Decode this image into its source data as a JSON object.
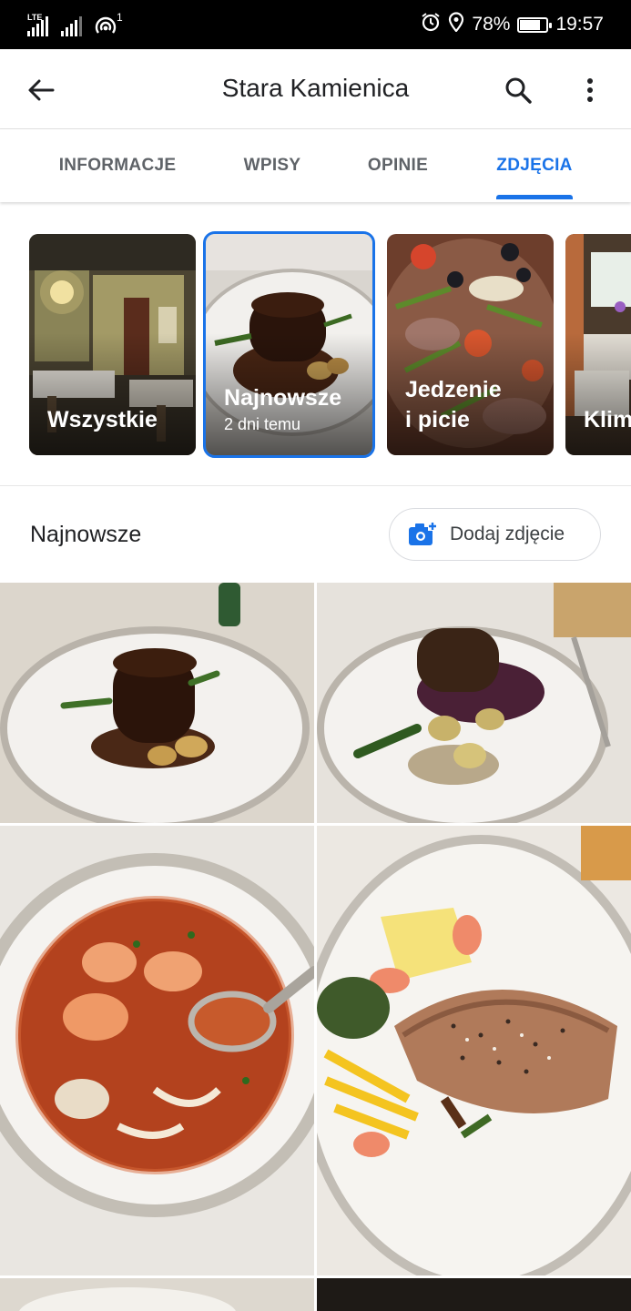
{
  "status_bar": {
    "network_label": "LTE",
    "hotspot_count": "1",
    "battery": "78%",
    "battery_level": 0.78,
    "time": "19:57"
  },
  "app_bar": {
    "title": "Stara Kamienica",
    "back_icon": "arrow-left-icon",
    "search_icon": "search-icon",
    "menu_icon": "more-vertical-icon"
  },
  "tabs": [
    {
      "label": "INFORMACJE",
      "active": false
    },
    {
      "label": "WPISY",
      "active": false
    },
    {
      "label": "OPINIE",
      "active": false
    },
    {
      "label": "ZDJĘCIA",
      "active": true
    }
  ],
  "categories": [
    {
      "label": "Wszystkie",
      "sub": ""
    },
    {
      "label": "Najnowsze",
      "sub": "2 dni temu",
      "selected": true
    },
    {
      "label_line1": "Jedzenie",
      "label_line2": "i picie"
    },
    {
      "label": "Klim"
    }
  ],
  "section": {
    "heading": "Najnowsze",
    "add_photo_label": "Dodaj zdjęcie"
  },
  "colors": {
    "accent": "#1a73e8",
    "tab_inactive": "#5f6368",
    "text_primary": "#202124"
  }
}
